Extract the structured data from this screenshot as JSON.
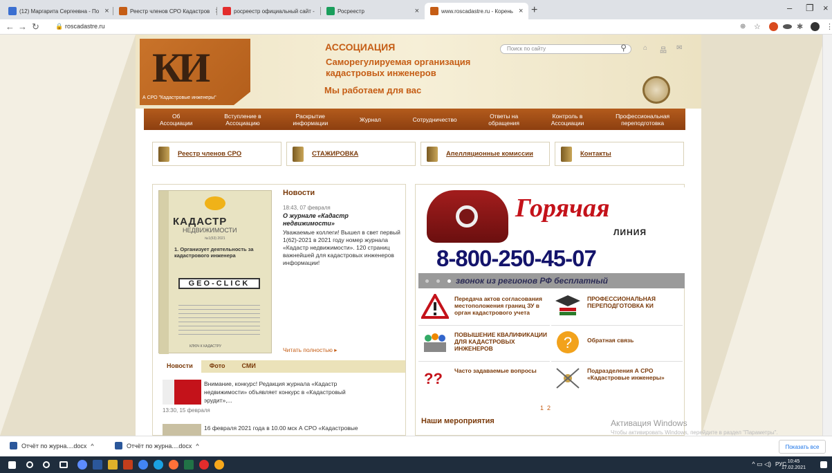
{
  "browser": {
    "tabs": [
      {
        "title": "(12) Маргарита Сергеевна - По",
        "fav": "#3b6fd1"
      },
      {
        "title": "Реестр членов СРО Кадастров",
        "fav": "#c55d15"
      },
      {
        "title": "росреестр официальный сайт -",
        "fav": "#e32c2c"
      },
      {
        "title": "Росреестр",
        "fav": "#1a9e5c"
      },
      {
        "title": "www.roscadastre.ru - Корень",
        "fav": "#c55d15"
      }
    ],
    "new_tab": "+",
    "url": "roscadastre.ru"
  },
  "header": {
    "logo_letters": "КИ",
    "logo_sub": "А СРО \"Кадастровые инженеры\"",
    "assoc": "АССОЦИАЦИЯ",
    "name": "Саморегулируемая организация кадастровых инженеров",
    "slogan": "Мы работаем для вас",
    "search_placeholder": "Поиск по сайту"
  },
  "nav": [
    "Об\nАссоциации",
    "Вступление в\nАссоциацию",
    "Раскрытие\nинформации",
    "Журнал",
    "Сотрудничество",
    "Ответы на\nобращения",
    "Контроль в\nАссоциации",
    "Профессиональная\nпереподготовка"
  ],
  "quick": [
    "Реестр членов СРО",
    "СТАЖИРОВКА",
    "Апелляционные комиссии",
    "Контакты"
  ],
  "magazine": {
    "title": "КАДАСТР",
    "subtitle": "НЕДВИЖИМОСТИ",
    "num": "№1(63) 2021",
    "article": "1. Организует деятельность за кадастрового инженера",
    "geo": "GEO-CLICK",
    "foot": "КЛЮЧ К КАДАСТРУ"
  },
  "news": {
    "heading": "Новости",
    "date": "18:43, 07 февраля",
    "title": "О журнале «Кадастр недвижимости»",
    "text": "Уважаемые коллеги! Вышел в свет первый 1(62)-2021 в 2021 году номер журнала «Кадастр недвижимости». 120 страниц важнейшей для кадастровых инженеров информации!",
    "more": "Читать полностью ▸",
    "tabs": [
      "Новости",
      "Фото",
      "СМИ"
    ],
    "items": [
      {
        "text": "Внимание, конкурс! Редакция журнала «Кадастр недвижимости» объявляет конкурс в «Кадастровый эрудит»,...",
        "date": "13:30, 15 февраля"
      },
      {
        "text": "16 февраля 2021 года в 10.00 мск А СРО «Кадастровые",
        "date": ""
      }
    ]
  },
  "hotline": {
    "word": "Горячая",
    "line": "ЛИНИЯ",
    "number": "8-800-250-45-07",
    "free": "звонок из регионов РФ бесплатный"
  },
  "cards": [
    "Передача актов согласования местоположения границ ЗУ в орган кадастрового учета",
    "ПРОФЕССИОНАЛЬНАЯ ПЕРЕПОДГОТОВКА КИ",
    "ПОВЫШЕНИЕ КВАЛИФИКАЦИИ ДЛЯ КАДАСТРОВЫХ ИНЖЕНЕРОВ",
    "Обратная связь",
    "Часто задаваемые вопросы",
    "Подразделения А СРО «Кадастровые инженеры»"
  ],
  "pager": "1  2",
  "events": "Наши мероприятия",
  "watermark": {
    "line1": "Активация Windows",
    "line2": "Чтобы активировать Windows, перейдите в раздел \"Параметры\"."
  },
  "downloads": [
    "Отчёт по журна....docx",
    "Отчёт по журна....docx"
  ],
  "show_all": "Показать все",
  "taskbar": {
    "lang": "РУС",
    "time": "10:45",
    "date": "17.02.2021"
  },
  "colors": {
    "accent": "#c55d15",
    "nav": "#a24d16",
    "hotline_red": "#c4121a",
    "number_blue": "#14146b"
  }
}
